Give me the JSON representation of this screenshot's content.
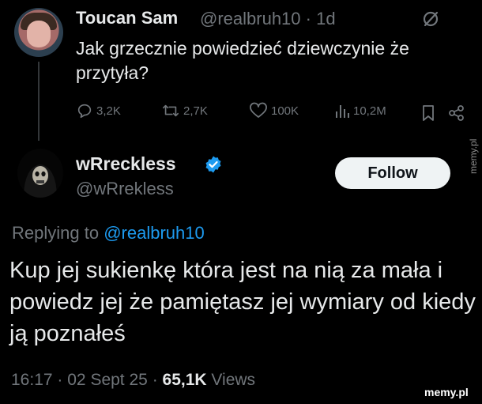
{
  "tweet1": {
    "author_name": "Toucan Sam",
    "handle": "@realbruh10",
    "separator": "·",
    "age": "1d",
    "text": "Jak grzecznie powiedzieć dziewczynie że przytyła?",
    "replies": "3,2K",
    "reposts": "2,7K",
    "likes": "100K",
    "views": "10,2M",
    "icons": [
      "grok-icon",
      "reply-icon",
      "repost-icon",
      "like-icon",
      "views-icon",
      "bookmark-icon",
      "share-icon"
    ]
  },
  "tweet2": {
    "author_name": "wRreckless",
    "handle": "@wRrekless",
    "follow_label": "Follow",
    "replying_prefix": "Replying to",
    "replying_to": "@realbruh10",
    "text": "Kup jej sukienkę która jest na nią za mała i powiedz jej że pamiętasz jej wymiary od kiedy ją poznałeś",
    "time": "16:17",
    "dot": "·",
    "date": "02 Sept 25",
    "views_count": "65,1K",
    "views_label": "Views"
  },
  "watermarks": {
    "side": "memy.pl",
    "bottom": "memy.pl"
  },
  "colors": {
    "background": "#000000",
    "text": "#e7e9ea",
    "secondary": "#71767b",
    "link": "#1d9bf0",
    "verified": "#1d9bf0",
    "follow_bg": "#eff3f4"
  }
}
